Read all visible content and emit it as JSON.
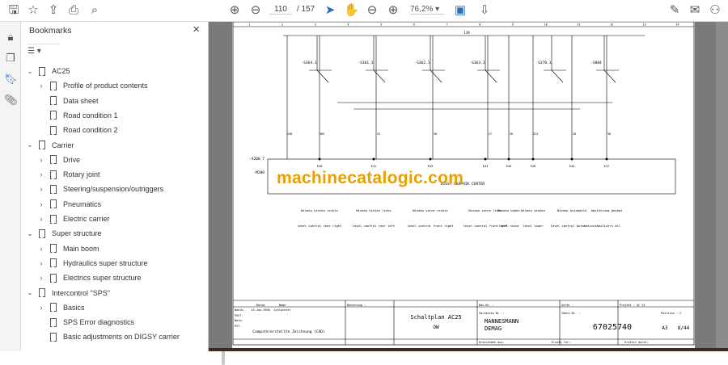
{
  "toolbar": {
    "page_current": "110",
    "page_total": "/ 157",
    "zoom": "76,2%"
  },
  "bookmarks": {
    "title": "Bookmarks",
    "options_icon": "list-options-icon",
    "items": [
      {
        "label": "AC25",
        "level": 0,
        "expandable": true
      },
      {
        "label": "Profile of product contents",
        "level": 1,
        "expandable": true
      },
      {
        "label": "Data sheet",
        "level": 1,
        "expandable": false
      },
      {
        "label": "Road condition 1",
        "level": 1,
        "expandable": false
      },
      {
        "label": "Road condition 2",
        "level": 1,
        "expandable": false
      },
      {
        "label": "Carrier",
        "level": 0,
        "expandable": true
      },
      {
        "label": "Drive",
        "level": 1,
        "expandable": true
      },
      {
        "label": "Rotary joint",
        "level": 1,
        "expandable": true
      },
      {
        "label": "Steering/suspension/outriggers",
        "level": 1,
        "expandable": true
      },
      {
        "label": "Pneumatics",
        "level": 1,
        "expandable": true
      },
      {
        "label": "Electric carrier",
        "level": 1,
        "expandable": true
      },
      {
        "label": "Super structure",
        "level": 0,
        "expandable": true
      },
      {
        "label": "Main boom",
        "level": 1,
        "expandable": true
      },
      {
        "label": "Hydraulics super structure",
        "level": 1,
        "expandable": true
      },
      {
        "label": "Electrics super structure",
        "level": 1,
        "expandable": true
      },
      {
        "label": "Intercontrol \"SPS\"",
        "level": 0,
        "expandable": true
      },
      {
        "label": "Basics",
        "level": 1,
        "expandable": true
      },
      {
        "label": "SPS Error diagnostics",
        "level": 1,
        "expandable": false
      },
      {
        "label": "Basic adjustments on DIGSY carrier",
        "level": 1,
        "expandable": false
      }
    ]
  },
  "schematic": {
    "watermark": "machinecatalogic.com",
    "bus_label": "139",
    "switches": [
      "-S364.1",
      "-S361.1",
      "-S362.1",
      "-S363.1",
      "-S370.1",
      "-S804"
    ],
    "x200": "-X200.7",
    "m200": "-M200",
    "box_label": "DIGSY GRAPHIK CENTER",
    "wires": [
      "338",
      "385",
      "25",
      "38",
      "27",
      "28",
      "313",
      "28",
      "38"
    ],
    "pins": [
      "E40",
      "E41",
      "E42",
      "E43",
      "E45",
      "E46",
      "E44",
      "E47"
    ],
    "funcs": [
      {
        "de": "Niveau hinten rechts",
        "en": "level control rear right"
      },
      {
        "de": "Niveau hinten links",
        "en": "level control rear left"
      },
      {
        "de": "Niveau vorne rechts",
        "en": "level control front right"
      },
      {
        "de": "Niveau vorne links",
        "en": "level control front left"
      },
      {
        "de": "Niveau heben",
        "en": "level raise"
      },
      {
        "de": "Niveau senken",
        "en": "level lower"
      },
      {
        "de": "Niveau Automatik",
        "en": "level control automatic"
      },
      {
        "de": "Abstützung gesamt",
        "en": "stabilizers all"
      }
    ],
    "title_block": {
      "rows": [
        "Bearb.",
        "Gepr.",
        "Norm.",
        "Ust."
      ],
      "datum": "Datum",
      "name": "Name",
      "date1": "15.Jan.1998",
      "name1": "Schlachter",
      "cad": "Computererstellte Zeichnung (CAD)",
      "benennung": "Benennung :",
      "title": "Schaltplan AC25",
      "subtitle": "OW",
      "company1": "MANNESMANN",
      "company2": "DEMAG",
      "ident": "67025740",
      "format": "A3",
      "sheet": "8/44",
      "projekt": "Projekt : AC 25",
      "position": "Position : 2",
      "bau": "Bau-Nr. :",
      "varianten": "Varianten-Nr. :",
      "geraet": "Gerät :",
      "ident_label": "Ident-Nr. :",
      "entstanden": "Entstanden aus:",
      "ersatz": "Ersatz für:",
      "ersetzt": "Ersetzt durch:"
    }
  }
}
